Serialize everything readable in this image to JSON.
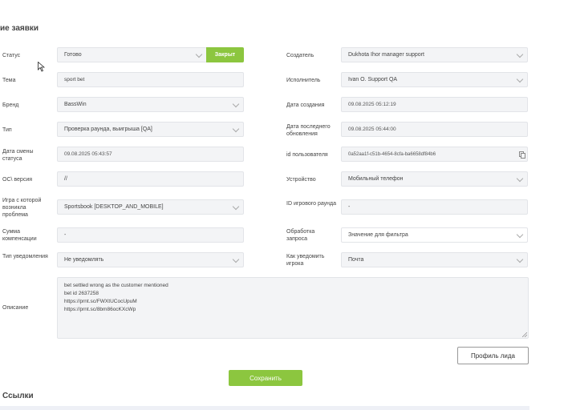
{
  "page": {
    "section_title": "ие заявки",
    "links_title": "Ссылки"
  },
  "left": {
    "status": {
      "label": "Статус",
      "value": "Готово",
      "badge": "Закрыт"
    },
    "topic": {
      "label": "Тема",
      "value": "sport bet"
    },
    "brand": {
      "label": "Бренд",
      "value": "BassWin"
    },
    "type": {
      "label": "Тип",
      "value": "Проверка раунда, выигрыша [QA]"
    },
    "status_change_date": {
      "label": "Дата смены статуса",
      "value": "09.08.2025 05:43:57"
    },
    "os_version": {
      "label": "ОС\\ версия",
      "value": "//"
    },
    "game": {
      "label": "Игра с которой возникла проблема",
      "value": "Sportsbook [DESKTOP_AND_MOBILE]"
    },
    "compensation": {
      "label": "Сумма компенсации",
      "value": "-"
    },
    "notify_type": {
      "label": "Тип уведомления",
      "value": "Не уведомлять"
    }
  },
  "right": {
    "creator": {
      "label": "Создатель",
      "value": "Dukhota Ihor manager support"
    },
    "assignee": {
      "label": "Исполнитель",
      "value": "Ivan O. Support QA"
    },
    "created_date": {
      "label": "Дата создания",
      "value": "09.08.2025 05:12:19"
    },
    "last_update": {
      "label": "Дата последнего обновления",
      "value": "09.08.2025 05:44:00"
    },
    "user_id": {
      "label": "id пользователя",
      "value": "0a52aa1f-c51b-4654-8cfa-ba6658df84b6"
    },
    "device": {
      "label": "Устройство",
      "value": "Мобильный телефон"
    },
    "round_id": {
      "label": "ID игрового раунда",
      "value": "-"
    },
    "request_handling": {
      "label": "Обработка запроса",
      "value": "Значение для фильтра"
    },
    "how_notify": {
      "label": "Как уведомить игрока",
      "value": "Почта"
    }
  },
  "description": {
    "label": "Описание",
    "lines": [
      "bet settled wrong as the customer mentioned",
      "bet id 2637258",
      "https://prnt.sc/FWXtUCocUpuM",
      "https://prnt.sc/8bm86ocKXcWp"
    ]
  },
  "buttons": {
    "lead_profile": "Профиль лида",
    "save": "Сохранить"
  },
  "colors": {
    "accent_green": "#8cc63f",
    "field_bg": "#f3f4f6"
  }
}
